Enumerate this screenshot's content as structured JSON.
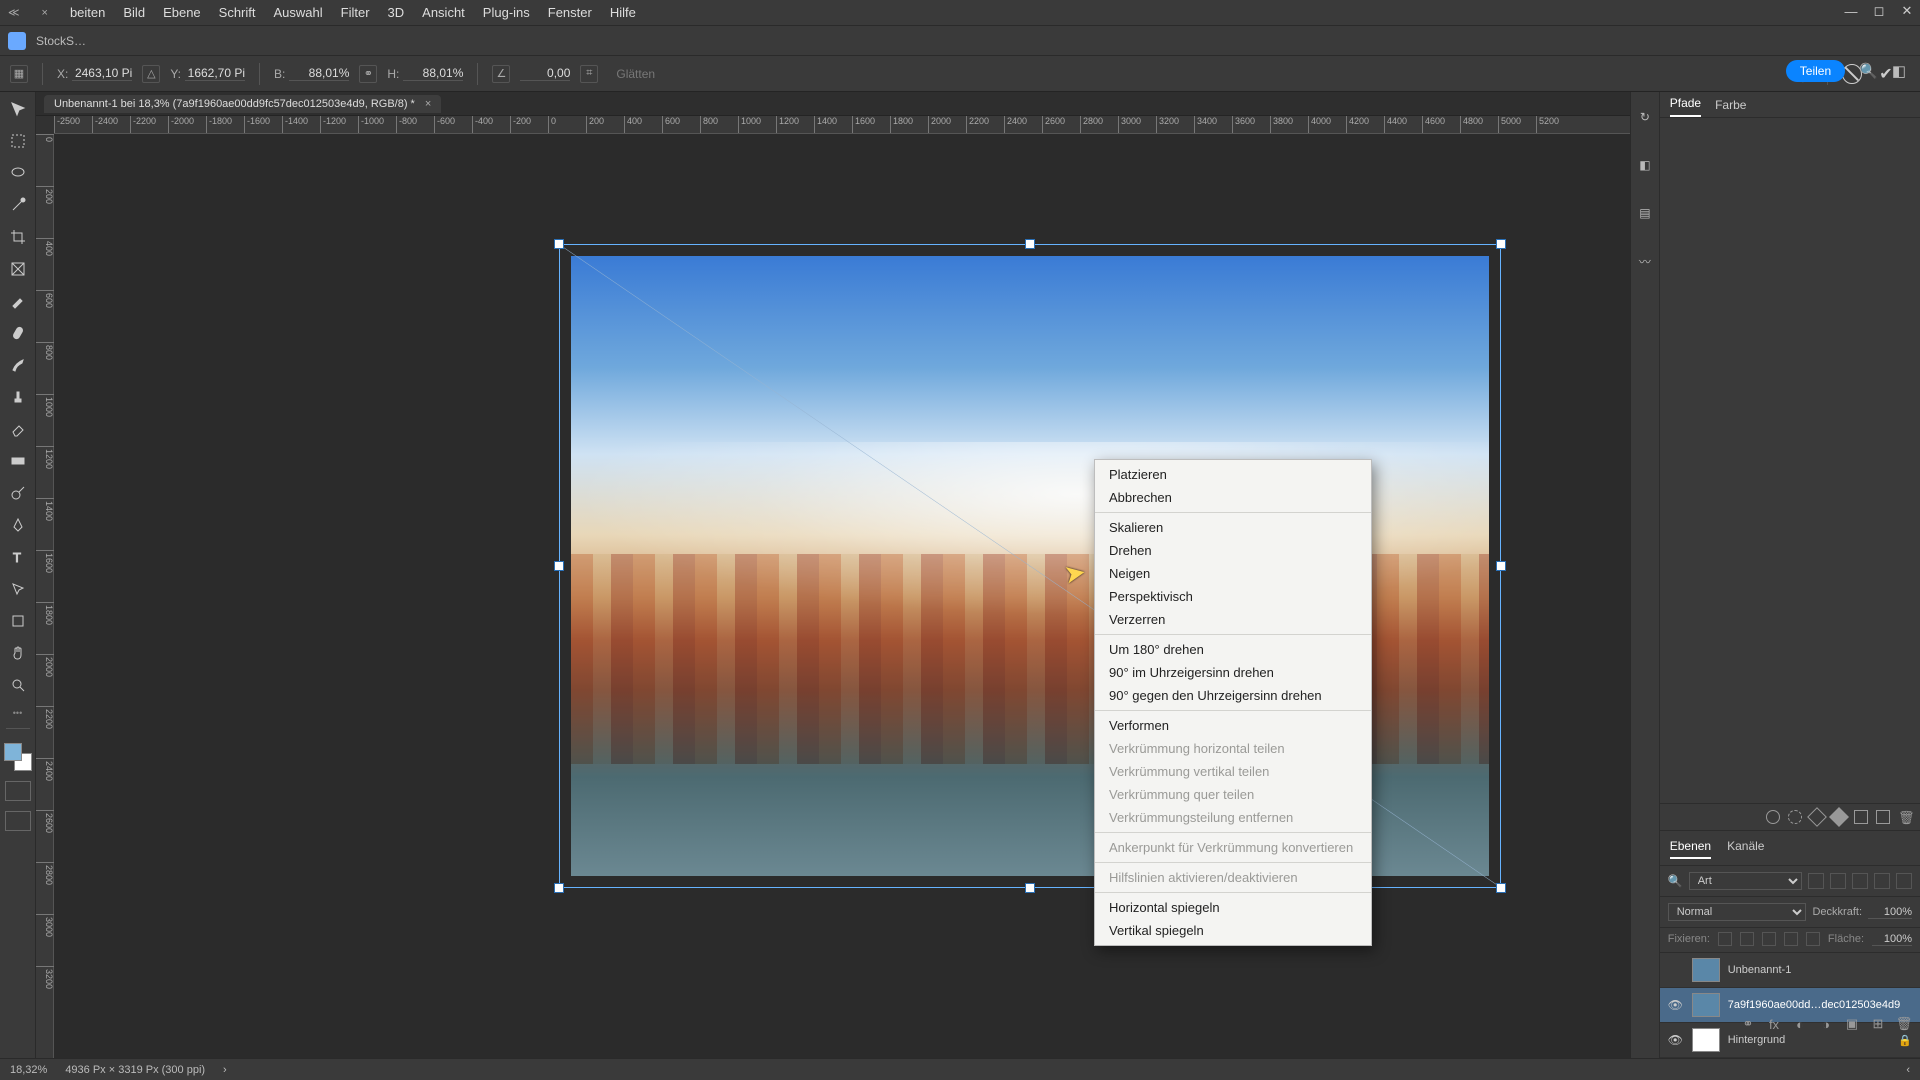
{
  "menubar": {
    "items": [
      "beiten",
      "Bild",
      "Ebene",
      "Schrift",
      "Auswahl",
      "Filter",
      "3D",
      "Ansicht",
      "Plug-ins",
      "Fenster",
      "Hilfe"
    ]
  },
  "home_tab": "StockS…",
  "options": {
    "x_label": "X:",
    "x_value": "2463,10 Pi",
    "y_label": "Y:",
    "y_value": "1662,70 Pi",
    "w_label": "B:",
    "w_value": "88,01%",
    "h_label": "H:",
    "h_value": "88,01%",
    "angle_value": "0,00",
    "glatten": "Glätten",
    "share": "Teilen"
  },
  "doc_tab": "Unbenannt-1 bei 18,3% (7a9f1960ae00dd9fc57dec012503e4d9, RGB/8) *",
  "ruler_h": [
    "-2500",
    "-2400",
    "-2200",
    "-2000",
    "-1800",
    "-1600",
    "-1400",
    "-1200",
    "-1000",
    "-800",
    "-600",
    "-400",
    "-200",
    "0",
    "200",
    "400",
    "600",
    "800",
    "1000",
    "1200",
    "1400",
    "1600",
    "1800",
    "2000",
    "2200",
    "2400",
    "2600",
    "2800",
    "3000",
    "3200",
    "3400",
    "3600",
    "3800",
    "4000",
    "4200",
    "4400",
    "4600",
    "4800",
    "5000",
    "5200"
  ],
  "ruler_v": [
    "0",
    "200",
    "400",
    "600",
    "800",
    "1000",
    "1200",
    "1400",
    "1600",
    "1800",
    "2000",
    "2200",
    "2400",
    "2600",
    "2800",
    "3000",
    "3200"
  ],
  "context_menu": {
    "groups": [
      [
        {
          "label": "Platzieren",
          "enabled": true
        },
        {
          "label": "Abbrechen",
          "enabled": true
        }
      ],
      [
        {
          "label": "Skalieren",
          "enabled": true
        },
        {
          "label": "Drehen",
          "enabled": true
        },
        {
          "label": "Neigen",
          "enabled": true
        },
        {
          "label": "Perspektivisch",
          "enabled": true
        },
        {
          "label": "Verzerren",
          "enabled": true
        }
      ],
      [
        {
          "label": "Um 180° drehen",
          "enabled": true
        },
        {
          "label": "90° im Uhrzeigersinn drehen",
          "enabled": true
        },
        {
          "label": "90° gegen den Uhrzeigersinn drehen",
          "enabled": true
        }
      ],
      [
        {
          "label": "Verformen",
          "enabled": true
        },
        {
          "label": "Verkrümmung horizontal teilen",
          "enabled": false
        },
        {
          "label": "Verkrümmung vertikal teilen",
          "enabled": false
        },
        {
          "label": "Verkrümmung quer teilen",
          "enabled": false
        },
        {
          "label": "Verkrümmungsteilung entfernen",
          "enabled": false
        }
      ],
      [
        {
          "label": "Ankerpunkt für Verkrümmung konvertieren",
          "enabled": false
        }
      ],
      [
        {
          "label": "Hilfslinien aktivieren/deaktivieren",
          "enabled": false
        }
      ],
      [
        {
          "label": "Horizontal spiegeln",
          "enabled": true
        },
        {
          "label": "Vertikal spiegeln",
          "enabled": true
        }
      ]
    ]
  },
  "right_panel": {
    "top_tabs": [
      "Pfade",
      "Farbe"
    ],
    "layers_tabs": [
      "Ebenen",
      "Kanäle"
    ],
    "search_kind": "Art",
    "blend_mode": "Normal",
    "opacity_label": "Deckkraft:",
    "opacity_value": "100%",
    "lock_label": "Fixieren:",
    "fill_label": "Fläche:",
    "fill_value": "100%",
    "layers": [
      {
        "visible": false,
        "name": "Unbenannt-1",
        "selected": false,
        "locked": false,
        "thumb": "img"
      },
      {
        "visible": true,
        "name": "7a9f1960ae00dd…dec012503e4d9",
        "selected": true,
        "locked": false,
        "thumb": "img"
      },
      {
        "visible": true,
        "name": "Hintergrund",
        "selected": false,
        "locked": true,
        "thumb": "white"
      }
    ]
  },
  "status": {
    "zoom": "18,32%",
    "dims": "4936 Px × 3319 Px (300 ppi)"
  }
}
